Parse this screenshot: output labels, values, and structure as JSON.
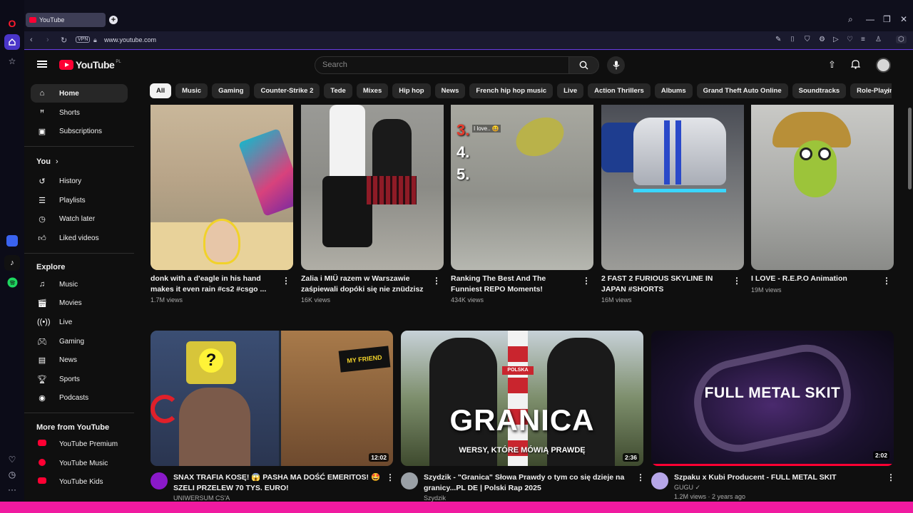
{
  "browser": {
    "tab_title": "YouTube",
    "new_tab": "+",
    "url": "www.youtube.com",
    "vpn_label": "VPN",
    "controls": [
      "search-icon",
      "minimize-icon",
      "restore-icon",
      "close-icon"
    ]
  },
  "masthead": {
    "logo_text": "YouTube",
    "logo_region": "PL",
    "search_placeholder": "Search"
  },
  "sidebar": {
    "primary": [
      {
        "label": "Home",
        "icon": "home-icon"
      },
      {
        "label": "Shorts",
        "icon": "shorts-icon"
      },
      {
        "label": "Subscriptions",
        "icon": "subscriptions-icon"
      }
    ],
    "you_heading": "You",
    "you_chevron": "›",
    "you": [
      {
        "label": "History",
        "icon": "history-icon"
      },
      {
        "label": "Playlists",
        "icon": "playlists-icon"
      },
      {
        "label": "Watch later",
        "icon": "clock-icon"
      },
      {
        "label": "Liked videos",
        "icon": "thumbs-up-icon"
      }
    ],
    "explore_heading": "Explore",
    "explore": [
      {
        "label": "Music",
        "icon": "music-note-icon"
      },
      {
        "label": "Movies",
        "icon": "clapperboard-icon"
      },
      {
        "label": "Live",
        "icon": "live-icon"
      },
      {
        "label": "Gaming",
        "icon": "gamepad-icon"
      },
      {
        "label": "News",
        "icon": "newspaper-icon"
      },
      {
        "label": "Sports",
        "icon": "trophy-icon"
      },
      {
        "label": "Podcasts",
        "icon": "podcast-icon"
      }
    ],
    "more_heading": "More from YouTube",
    "more": [
      {
        "label": "YouTube Premium"
      },
      {
        "label": "YouTube Music"
      },
      {
        "label": "YouTube Kids"
      }
    ]
  },
  "chips": [
    "All",
    "Music",
    "Gaming",
    "Counter-Strike 2",
    "Tede",
    "Mixes",
    "Hip hop",
    "News",
    "French hip hop music",
    "Live",
    "Action Thrillers",
    "Albums",
    "Grand Theft Auto Online",
    "Soundtracks",
    "Role-Playing Games"
  ],
  "shorts": [
    {
      "title": "donk with a d'eagle in his hand makes it even rain  #cs2 #csgo ...",
      "views": "1.7M views"
    },
    {
      "title": "Zalia i MIÜ razem w Warszawie zaśpiewali dopóki się nie znüdzisz",
      "views": "16K views"
    },
    {
      "title": "Ranking The Best And The Funniest REPO Moments!",
      "views": "434K views"
    },
    {
      "title": "2 FAST 2 FURIOUS SKYLINE IN JAPAN #SHORTS",
      "views": "16M views"
    },
    {
      "title": "I LOVE - R.E.P.O Animation",
      "views": "19M views"
    }
  ],
  "short_overlays": {
    "rank_lines": [
      "3.",
      "4.",
      "5."
    ],
    "rank_caption": "I love.. 😆"
  },
  "videos": [
    {
      "title": "SNAX TRAFIA KOSĘ! 😱 PASHA MA DOŚĆ EMERITOS! 🤩 SZELI PRZELEW 70 TYS. EURO!",
      "channel": "UNIWERSUM CS'A",
      "meta": "",
      "duration": "12:02",
      "thumb_text": "",
      "thumb_sub": ""
    },
    {
      "title": "Szydzik - \"Granica\" Słowa Prawdy o tym co się dzieje na granicy...PL DE | Polski Rap 2025",
      "channel": "Szydzik",
      "meta": "",
      "duration": "2:36",
      "thumb_text": "GRANICA",
      "thumb_sub": "WERSY, KTÓRE MÓWIĄ PRAWDĘ"
    },
    {
      "title": "Szpaku x Kubi Producent - FULL METAL SKIT",
      "channel": "GUGU",
      "meta": "1.2M views · 2 years ago",
      "duration": "2:02",
      "thumb_text": "FULL METAL SKIT",
      "thumb_sub": ""
    }
  ],
  "thumb_labels": {
    "polska": "POLSKA",
    "my_friend": "MY FRIEND"
  },
  "colors": {
    "accent": "#ff0033",
    "opera_pink": "#f01aa0",
    "opera_purple": "#6a3de0"
  }
}
